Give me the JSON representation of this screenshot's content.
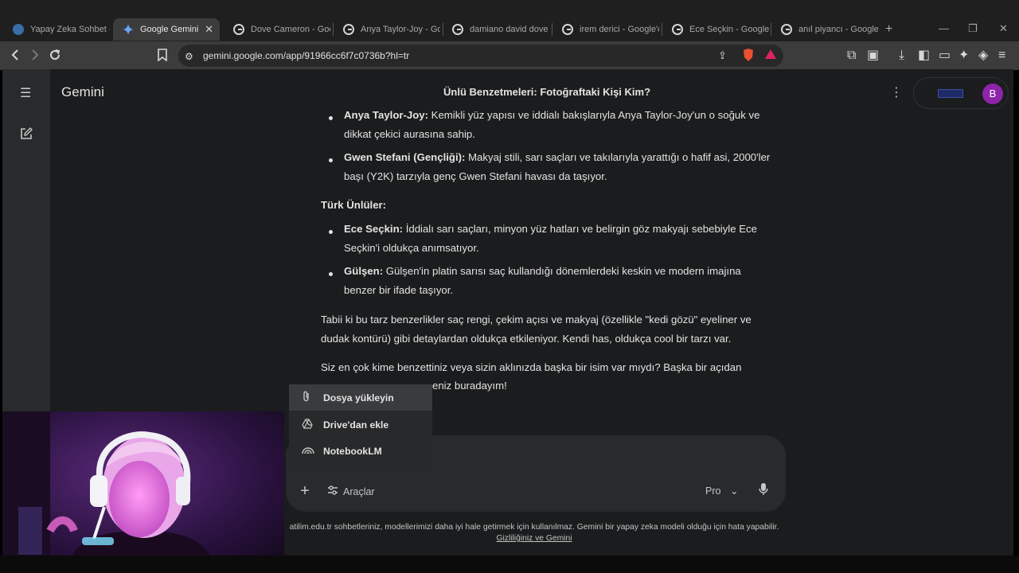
{
  "browser": {
    "tabs": [
      {
        "title": "Yapay Zeka Sohbet - I",
        "active": false
      },
      {
        "title": "Google Gemini",
        "active": true
      },
      {
        "title": "Dove Cameron - Goo",
        "active": false
      },
      {
        "title": "Anya Taylor-Joy - Goo",
        "active": false
      },
      {
        "title": "damiano david dove c",
        "active": false
      },
      {
        "title": "irem derici - Google'd",
        "active": false
      },
      {
        "title": "Ece Seçkin - Google'd",
        "active": false
      },
      {
        "title": "anıl piyancı - Google'd",
        "active": false
      }
    ],
    "url_host": "gemini.google.com",
    "url_path": "/app/91966cc6f7c0736b?hl=tr"
  },
  "app": {
    "brand": "Gemini",
    "chat_title": "Ünlü Benzetmeleri: Fotoğraftaki Kişi Kim?",
    "avatar_letter": "B"
  },
  "response": {
    "anya_name": "Anya Taylor-Joy:",
    "anya_text": " Kemikli yüz yapısı ve iddialı bakışlarıyla Anya Taylor-Joy'un o soğuk ve dikkat çekici aurasına sahip.",
    "gwen_name": "Gwen Stefani (Gençliği):",
    "gwen_text": " Makyaj stili, sarı saçları ve takılarıyla yarattığı o hafif asi, 2000'ler başı (Y2K) tarzıyla genç Gwen Stefani havası da taşıyor.",
    "turk_heading": "Türk Ünlüler:",
    "ece_name": "Ece Seçkin:",
    "ece_text": " İddialı sarı saçları, minyon yüz hatları ve belirgin göz makyajı sebebiyle Ece Seçkin'i oldukça anımsatıyor.",
    "gulsen_name": "Gülşen:",
    "gulsen_text": " Gülşen'in platin sarısı saç kullandığı dönemlerdeki keskin ve modern imajına benzer bir ifade taşıyor.",
    "para1": "Tabii ki bu tarz benzerlikler saç rengi, çekim açısı ve makyaj (özellikle \"kedi gözü\" eyeliner ve dudak kontürü) gibi detaylardan oldukça etkileniyor. Kendi has, oldukça cool bir tarzı var.",
    "para2_line1": "Siz en çok kime benzettiniz veya sizin aklınızda başka bir isim var mıydı? Başka bir açıdan",
    "para2_line2": "eniz buradayım!"
  },
  "attach_menu": {
    "items": [
      {
        "label": "Dosya yükleyin",
        "icon": "paperclip-icon"
      },
      {
        "label": "Drive'dan ekle",
        "icon": "drive-icon"
      },
      {
        "label": "NotebookLM",
        "icon": "notebooklm-icon"
      }
    ]
  },
  "prompt": {
    "tools_label": "Araçlar",
    "model_label": "Pro"
  },
  "footer": {
    "notice": "atilim.edu.tr sohbetleriniz, modellerimizi daha iyi hale getirmek için kullanılmaz. Gemini bir yapay zeka modeli olduğu için hata yapabilir.",
    "link": "Gizliliğiniz ve Gemini"
  },
  "colors": {
    "app_bg": "#1b1c1d",
    "rail_bg": "#282a2c",
    "avatar": "#8e24aa",
    "menu_highlight": "#3a3b3d"
  }
}
